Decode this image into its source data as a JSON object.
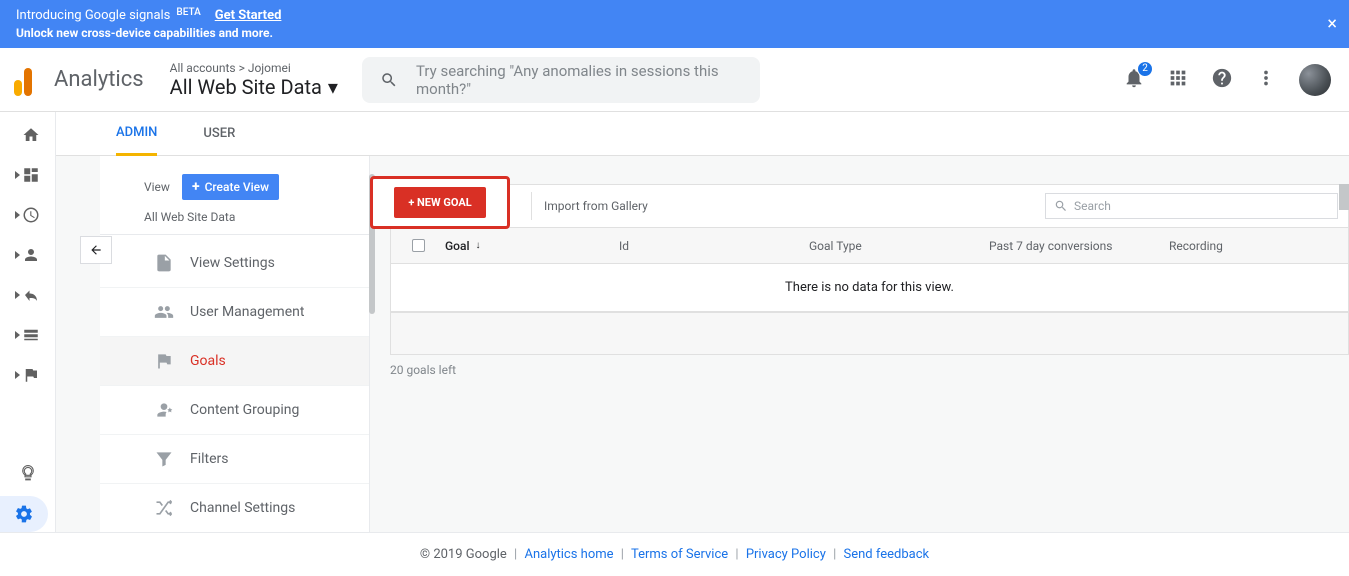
{
  "banner": {
    "title": "Introducing Google signals",
    "badge": "BETA",
    "subtitle": "Unlock new cross-device capabilities and more.",
    "cta": "Get Started"
  },
  "header": {
    "app_name": "Analytics",
    "breadcrumb_all": "All accounts",
    "breadcrumb_account": "Jojomei",
    "view_name": "All Web Site Data",
    "search_placeholder": "Try searching \"Any anomalies in sessions this month?\"",
    "notification_count": "2"
  },
  "tabs": {
    "admin": "ADMIN",
    "user": "USER"
  },
  "admin_col": {
    "view_label": "View",
    "create_view": "Create View",
    "view_name": "All Web Site Data",
    "items": [
      {
        "label": "View Settings",
        "icon": "file"
      },
      {
        "label": "User Management",
        "icon": "users"
      },
      {
        "label": "Goals",
        "icon": "flag",
        "active": true
      },
      {
        "label": "Content Grouping",
        "icon": "person-star"
      },
      {
        "label": "Filters",
        "icon": "funnel"
      },
      {
        "label": "Channel Settings",
        "icon": "shuffle"
      }
    ]
  },
  "goals": {
    "new_goal": "+ NEW GOAL",
    "import_gallery": "Import from Gallery",
    "search_placeholder": "Search",
    "columns": {
      "goal": "Goal",
      "id": "Id",
      "type": "Goal Type",
      "conversions": "Past 7 day conversions",
      "recording": "Recording"
    },
    "empty": "There is no data for this view.",
    "goals_left": "20 goals left"
  },
  "footer": {
    "copyright": "© 2019 Google",
    "links": {
      "home": "Analytics home",
      "tos": "Terms of Service",
      "privacy": "Privacy Policy",
      "feedback": "Send feedback"
    }
  }
}
